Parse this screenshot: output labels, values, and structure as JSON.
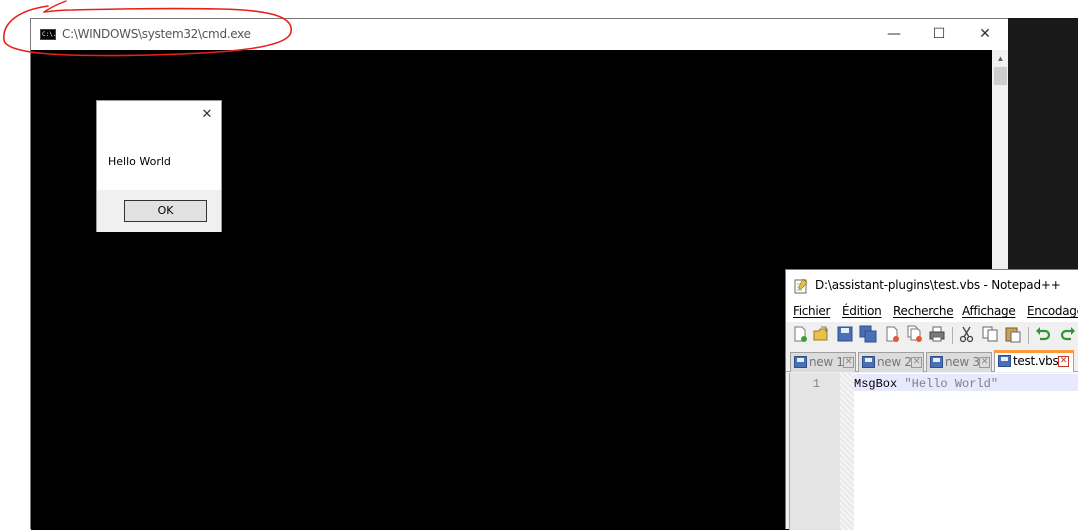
{
  "cmd": {
    "title": "C:\\WINDOWS\\system32\\cmd.exe",
    "icon_text": "C:\\.",
    "minimize_glyph": "—",
    "maximize_glyph": "☐",
    "close_glyph": "✕"
  },
  "msgbox": {
    "message": "Hello World",
    "ok_label": "OK",
    "close_glyph": "✕"
  },
  "notepadpp": {
    "title": "D:\\assistant-plugins\\test.vbs - Notepad++",
    "menu": [
      "Fichier",
      "Édition",
      "Recherche",
      "Affichage",
      "Encodage"
    ],
    "toolbar_icons": [
      "new-file-icon",
      "open-file-icon",
      "save-icon",
      "save-all-icon",
      "close-icon",
      "close-all-icon",
      "print-icon",
      "cut-icon",
      "copy-icon",
      "paste-icon",
      "undo-icon",
      "redo-icon"
    ],
    "tabs": [
      {
        "label": "new 1",
        "active": false
      },
      {
        "label": "new 2",
        "active": false
      },
      {
        "label": "new 3",
        "active": false
      },
      {
        "label": "test.vbs",
        "active": true
      }
    ],
    "editor": {
      "line_number": "1",
      "code_keyword": "MsgBox ",
      "code_string": "\"Hello World\""
    }
  },
  "colors": {
    "annotation": "#e8201a",
    "console_bg": "#000000",
    "active_tab_accent": "#fa9a38"
  }
}
